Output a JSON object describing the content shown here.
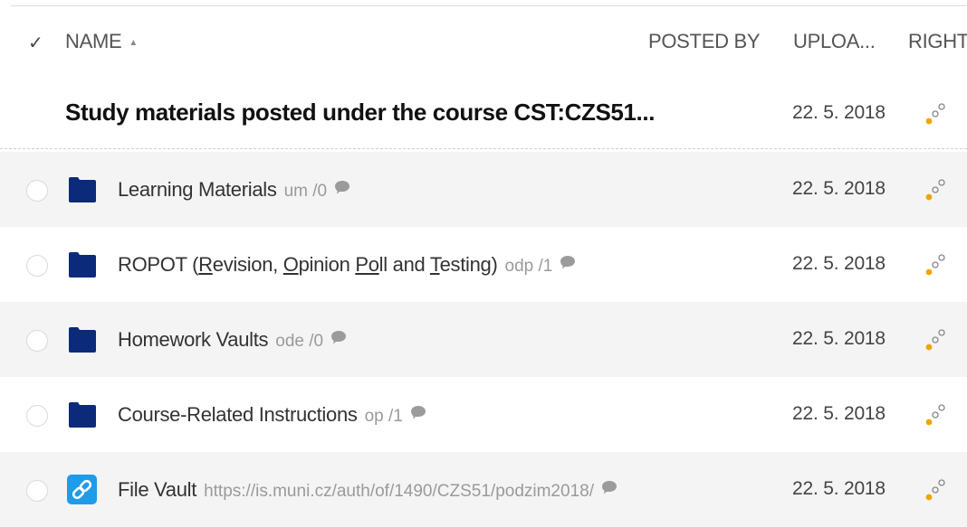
{
  "header": {
    "check_mark": "✓",
    "name": "NAME",
    "sort_indicator": "▲",
    "posted_by": "POSTED BY",
    "uploaded": "UPLOA...",
    "rights": "RIGHTS"
  },
  "group": {
    "title": "Study materials posted under the course CST:CZS51...",
    "date": "22. 5. 2018"
  },
  "rows": [
    {
      "type": "folder",
      "title": "Learning Materials",
      "meta": "um /0",
      "date": "22. 5. 2018"
    },
    {
      "type": "folder",
      "title_parts": [
        "ROPOT (",
        "R",
        "evision, ",
        "O",
        "pinion ",
        "Po",
        "ll and ",
        "T",
        "esting)"
      ],
      "meta": "odp /1",
      "date": "22. 5. 2018"
    },
    {
      "type": "folder",
      "title": "Homework Vaults",
      "meta": "ode /0",
      "date": "22. 5. 2018"
    },
    {
      "type": "folder",
      "title": "Course-Related Instructions",
      "meta": "op /1",
      "date": "22. 5. 2018"
    },
    {
      "type": "link",
      "title": "File Vault",
      "meta": "https://is.muni.cz/auth/of/1490/CZS51/podzim2018/",
      "date": "22. 5. 2018"
    }
  ],
  "colors": {
    "folder": "#0b2a7a",
    "link_bg": "#1e9be9",
    "rights_dot": "#f0a500",
    "comment": "#9b9b9b"
  },
  "icons": {
    "folder": "folder-icon",
    "link": "link-icon",
    "comment": "comment-icon",
    "rights": "rights-icon"
  }
}
